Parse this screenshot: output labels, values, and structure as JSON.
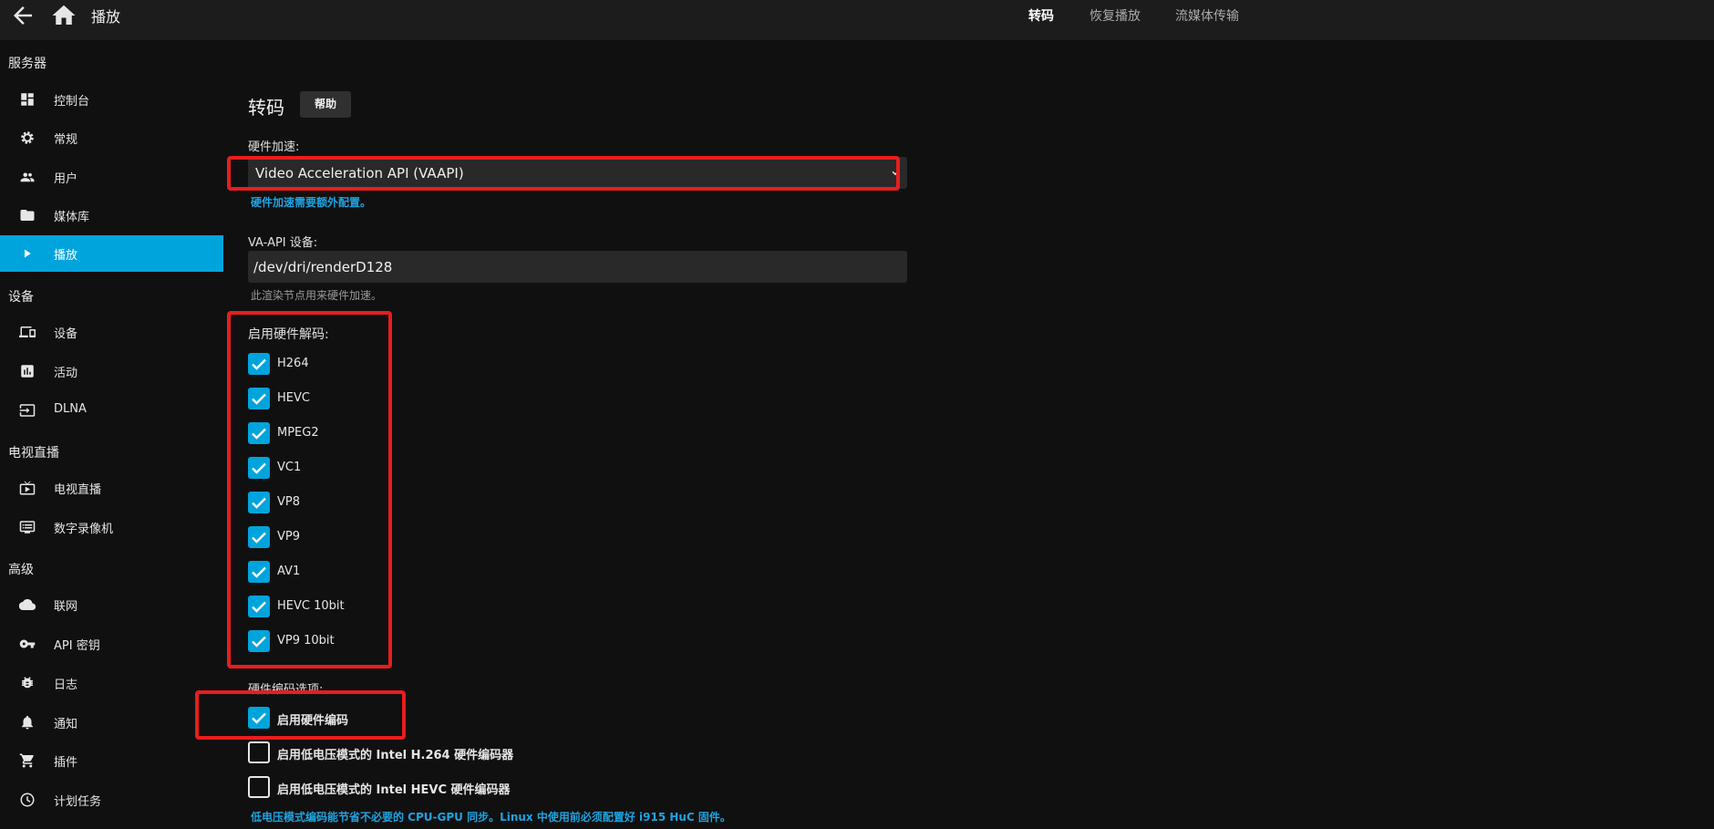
{
  "header": {
    "title": "播放",
    "tabs": [
      {
        "label": "转码",
        "active": true
      },
      {
        "label": "恢复播放",
        "active": false
      },
      {
        "label": "流媒体传输",
        "active": false
      }
    ]
  },
  "sidebar": {
    "sections": [
      {
        "title": "服务器",
        "items": [
          {
            "label": "控制台",
            "icon": "dashboard-icon"
          },
          {
            "label": "常规",
            "icon": "gear-icon"
          },
          {
            "label": "用户",
            "icon": "people-icon"
          },
          {
            "label": "媒体库",
            "icon": "folder-icon"
          },
          {
            "label": "播放",
            "icon": "play-icon",
            "active": true
          }
        ]
      },
      {
        "title": "设备",
        "items": [
          {
            "label": "设备",
            "icon": "devices-icon"
          },
          {
            "label": "活动",
            "icon": "activity-icon"
          },
          {
            "label": "DLNA",
            "icon": "input-icon"
          }
        ]
      },
      {
        "title": "电视直播",
        "items": [
          {
            "label": "电视直播",
            "icon": "live-tv-icon"
          },
          {
            "label": "数字录像机",
            "icon": "dvr-icon"
          }
        ]
      },
      {
        "title": "高级",
        "items": [
          {
            "label": "联网",
            "icon": "cloud-icon"
          },
          {
            "label": "API 密钥",
            "icon": "key-icon"
          },
          {
            "label": "日志",
            "icon": "bug-icon"
          },
          {
            "label": "通知",
            "icon": "bell-icon"
          },
          {
            "label": "插件",
            "icon": "cart-icon"
          },
          {
            "label": "计划任务",
            "icon": "clock-icon"
          }
        ]
      }
    ]
  },
  "main": {
    "title": "转码",
    "help_label": "帮助",
    "hw_accel": {
      "label": "硬件加速:",
      "value": "Video Acceleration API (VAAPI)",
      "hint": "硬件加速需要额外配置。"
    },
    "vaapi": {
      "label": "VA-API 设备:",
      "value": "/dev/dri/renderD128",
      "hint": "此渲染节点用来硬件加速。"
    },
    "decoding": {
      "label": "启用硬件解码:",
      "codecs": [
        {
          "label": "H264",
          "checked": true
        },
        {
          "label": "HEVC",
          "checked": true
        },
        {
          "label": "MPEG2",
          "checked": true
        },
        {
          "label": "VC1",
          "checked": true
        },
        {
          "label": "VP8",
          "checked": true
        },
        {
          "label": "VP9",
          "checked": true
        },
        {
          "label": "AV1",
          "checked": true
        },
        {
          "label": "HEVC 10bit",
          "checked": true
        },
        {
          "label": "VP9 10bit",
          "checked": true
        }
      ]
    },
    "encoding": {
      "label": "硬件编码选项:",
      "options": [
        {
          "label": "启用硬件编码",
          "checked": true
        },
        {
          "label": "启用低电压模式的 Intel H.264 硬件编码器",
          "checked": false
        },
        {
          "label": "启用低电压模式的 Intel HEVC 硬件编码器",
          "checked": false
        }
      ],
      "hint": "低电压模式编码能节省不必要的 CPU-GPU 同步。Linux 中使用前必须配置好 i915 HuC 固件。"
    }
  },
  "colors": {
    "accent": "#00a4dc",
    "annotation": "#e81d1d"
  }
}
